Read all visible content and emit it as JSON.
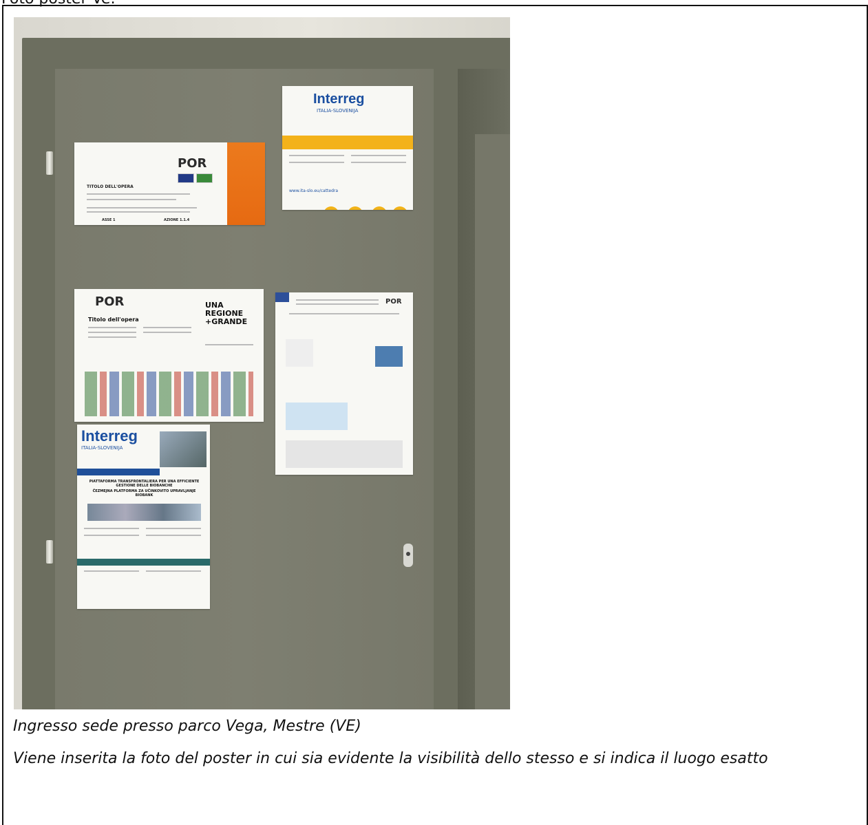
{
  "header_text": "Foto poster Ve:",
  "caption": {
    "line1": "Ingresso sede presso parco Vega, Mestre (VE)",
    "line2": "Viene inserita la foto del poster in cui sia evidente la visibilità dello stesso e si indica il luogo esatto"
  },
  "photo": {
    "description_icons": [
      "door-icon"
    ],
    "poster_por_top": {
      "logo": "POR",
      "heading": "TITOLO DELL'OPERA",
      "asse": "ASSE 1",
      "azione": "AZIONE 1.1.4"
    },
    "poster_interreg_top": {
      "logo": "Interreg",
      "subtitle": "ITALIA-SLOVENIJA",
      "url": "www.ita-slo.eu/cattedra"
    },
    "poster_por_middle": {
      "logo": "POR",
      "heading": "UNA REGIONE +GRANDE",
      "title": "Titolo dell'opera"
    },
    "poster_interreg_bottom": {
      "logo": "Interreg",
      "subtitle": "ITALIA-SLOVENIJA",
      "heading1": "PIATTAFORMA TRANSFRONTALIERA PER UNA EFFICIENTE GESTIONE DELLE BIOBANCHE",
      "heading2": "ČEZMEJNA PLATFORMA ZA UČINKOVITO UPRAVLJANJE BIOBANK"
    },
    "poster_white_right": {
      "logo": "POR"
    }
  },
  "colors": {
    "door": "#7b7c6e",
    "frame": "#6c6e5f",
    "orange": "#e66a12",
    "interreg_blue": "#1b4fa0",
    "yellow": "#f3b21a"
  }
}
